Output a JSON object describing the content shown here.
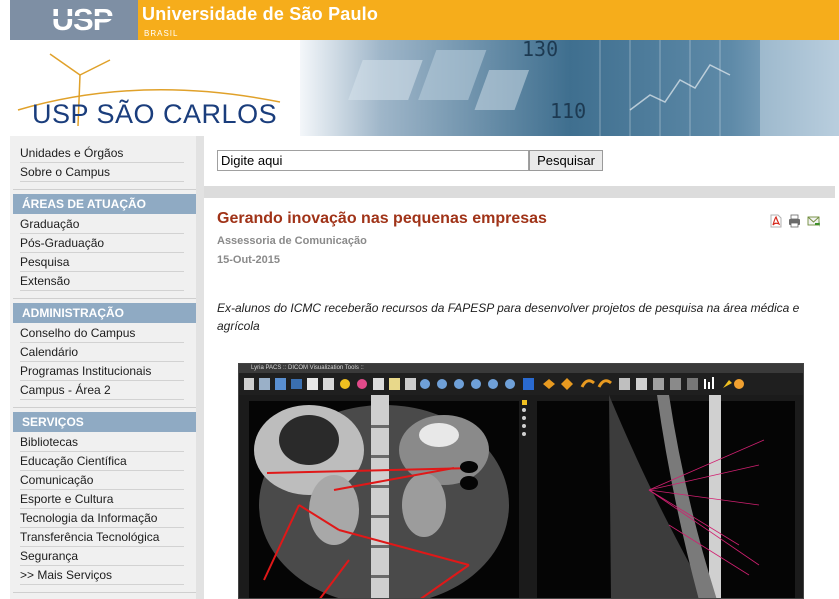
{
  "header": {
    "logo_text": "USP",
    "university_name": "Universidade de São Paulo",
    "country": "BRASIL",
    "campus_name": "USP SÃO CARLOS",
    "banner_numbers": [
      "130",
      "110"
    ]
  },
  "colors": {
    "header_orange": "#f6ad1b",
    "logo_gray": "#7e8fa4",
    "section_blue": "#8faac3",
    "title_red": "#a03318",
    "campus_blue": "#1a3d7c"
  },
  "sidebar": {
    "top_items": [
      "Unidades e Órgãos",
      "Sobre o Campus"
    ],
    "sections": [
      {
        "title": "ÁREAS DE ATUAÇÃO",
        "items": [
          "Graduação",
          "Pós-Graduação",
          "Pesquisa",
          "Extensão"
        ]
      },
      {
        "title": "ADMINISTRAÇÃO",
        "items": [
          "Conselho do Campus",
          "Calendário",
          "Programas Institucionais",
          "Campus - Área 2"
        ]
      },
      {
        "title": "SERVIÇOS",
        "items": [
          "Bibliotecas",
          "Educação Científica",
          "Comunicação",
          "Esporte e Cultura",
          "Tecnologia da Informação",
          "Transferência Tecnológica",
          "Segurança",
          ">> Mais Serviços"
        ]
      }
    ]
  },
  "search": {
    "value": "Digite aqui",
    "button_label": "Pesquisar"
  },
  "article": {
    "title": "Gerando inovação nas pequenas empresas",
    "author": "Assessoria de Comunicação",
    "date": "15-Out-2015",
    "lead": "Ex-alunos do ICMC receberão recursos da FAPESP para desenvolver projetos de pesquisa na área médica e agrícola",
    "tool_icons": [
      "pdf-icon",
      "print-icon",
      "email-icon"
    ]
  },
  "figure": {
    "window_title": "Lyria PACS :: DICOM Visualization Tools ::"
  }
}
